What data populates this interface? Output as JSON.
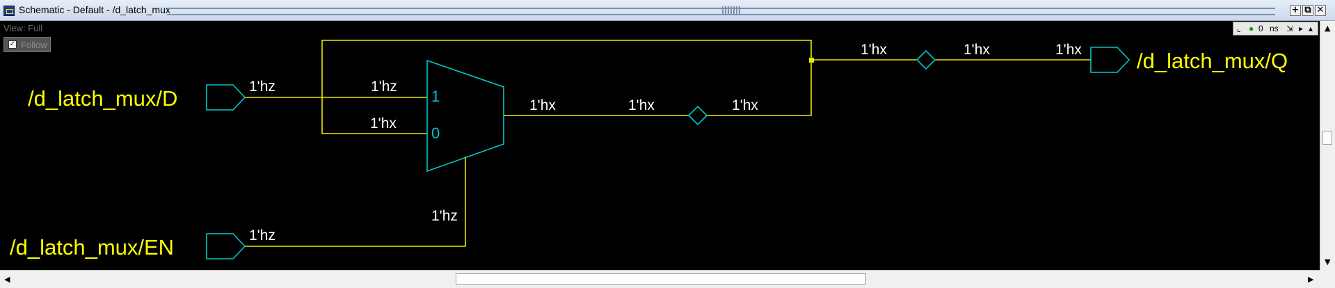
{
  "window": {
    "title": "Schematic - Default - /d_latch_mux",
    "buttons": [
      "+",
      "⧉",
      "✕"
    ]
  },
  "canvas": {
    "background": "#000000",
    "wire_color": "#e8e800",
    "symbol_color": "#00c8c8",
    "label_color": "#ffffff",
    "port_text_color": "#ffff00"
  },
  "view_label": "View: Full",
  "follow": {
    "label": "Follow",
    "checked": true
  },
  "sim_toolbar": {
    "time_value": "0",
    "time_unit": "ns"
  },
  "ports": {
    "d": "/d_latch_mux/D",
    "en": "/d_latch_mux/EN",
    "q": "/d_latch_mux/Q"
  },
  "mux": {
    "input1": "1",
    "input0": "0"
  },
  "signal_values": {
    "d_out": "1'hz",
    "mux_in1": "1'hz",
    "mux_in0": "1'hx",
    "en_out": "1'hz",
    "mux_sel": "1'hz",
    "mux_out": "1'hx",
    "buf1_in": "1'hx",
    "buf1_out": "1'hx",
    "q_net": "1'hx",
    "buf2_out": "1'hx",
    "q_in": "1'hx"
  }
}
